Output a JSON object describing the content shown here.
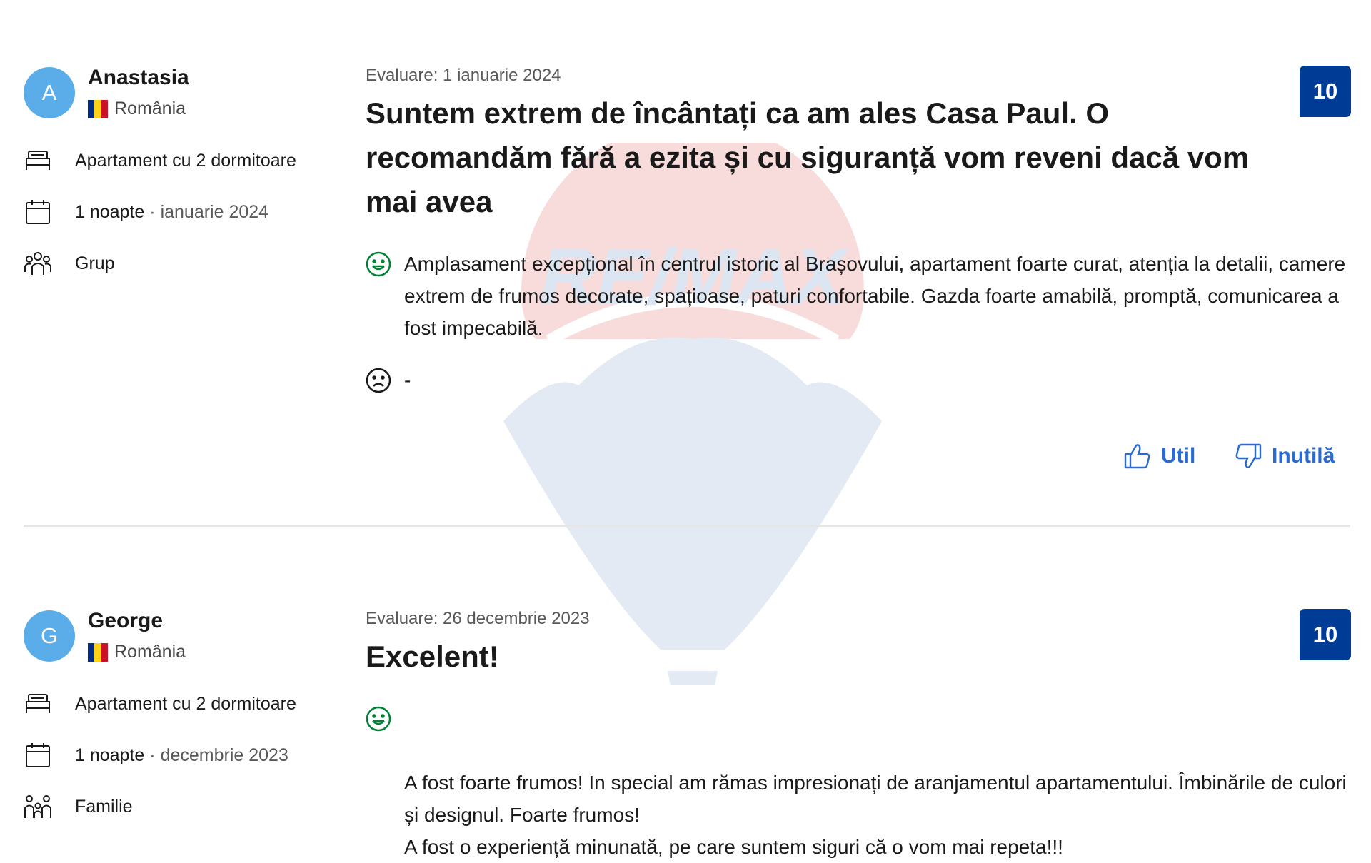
{
  "watermark": {
    "brand": "RE/MAX"
  },
  "reviews": [
    {
      "avatar_initial": "A",
      "name": "Anastasia",
      "country": "România",
      "room": "Apartament cu 2 dormitoare",
      "stay_nights": "1 noapte",
      "stay_sep": "·",
      "stay_month": "ianuarie 2024",
      "traveler_type": "Grup",
      "date": "Evaluare: 1 ianuarie 2024",
      "title": "Suntem extrem de încântați ca am ales Casa Paul. O recomandăm fără a ezita și cu siguranță vom reveni dacă vom mai avea",
      "positive": "Amplasament excepțional în centrul istoric al Brașovului, apartament foarte curat, atenția la detalii, camere extrem de frumos decorate, spațioase, paturi confortabile. Gazda foarte amabilă, promptă, comunicarea a fost impecabilă.",
      "negative": "-",
      "score": "10",
      "helpful_label": "Util",
      "unhelpful_label": "Inutilă"
    },
    {
      "avatar_initial": "G",
      "name": "George",
      "country": "România",
      "room": "Apartament cu 2 dormitoare",
      "stay_nights": "1 noapte",
      "stay_sep": "·",
      "stay_month": "decembrie 2023",
      "traveler_type": "Familie",
      "date": "Evaluare: 26 decembrie 2023",
      "title": "Excelent!",
      "positive": "A fost foarte frumos! In special am rămas impresionați de aranjamentul apartamentului. Îmbinările de culori și designul. Foarte frumos!\nA fost o experiență minunată, pe care suntem siguri că o vom mai repeta!!!",
      "score": "10"
    }
  ],
  "icons": {
    "bed": "bed-icon",
    "calendar": "calendar-icon",
    "group": "group-icon",
    "family": "family-icon",
    "positive": "smile-icon",
    "negative": "frown-icon",
    "helpful": "thumbs-up-icon",
    "unhelpful": "thumbs-down-icon"
  },
  "colors": {
    "avatar": "#5aade8",
    "score_badge": "#003b95",
    "positive_icon": "#008234",
    "vote_link": "#2a6bd3",
    "flag": [
      "#002b7f",
      "#fcd116",
      "#ce1126"
    ]
  }
}
